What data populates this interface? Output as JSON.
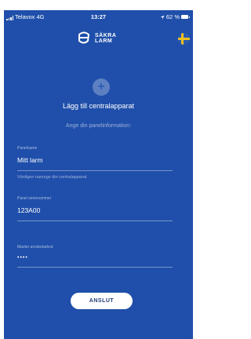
{
  "status_bar": {
    "carrier": "Telavox",
    "network": "4G",
    "time": "13:27",
    "battery": "62 %"
  },
  "header": {
    "logo_line1": "SÄKRA",
    "logo_line2": "LARM",
    "language_icon": "swedish-flag-icon"
  },
  "main": {
    "add_icon": "plus-icon",
    "title": "Lägg till centralapparat",
    "subtitle": "Ange din panelinformation:",
    "fields": [
      {
        "label": "Panelnamn",
        "value": "Mitt larm",
        "hint": "Vänligen namnge din centralapparat"
      },
      {
        "label": "Panel serienummer",
        "value": "123A00"
      },
      {
        "label": "Master användarkod",
        "value": "••••"
      }
    ],
    "connect_label": "ANSLUT"
  },
  "colors": {
    "background": "#1f4faa",
    "button": "#ffffff",
    "button_text": "#1e3c78",
    "flag_blue": "#2a5ab0",
    "flag_yellow": "#f0c020"
  }
}
